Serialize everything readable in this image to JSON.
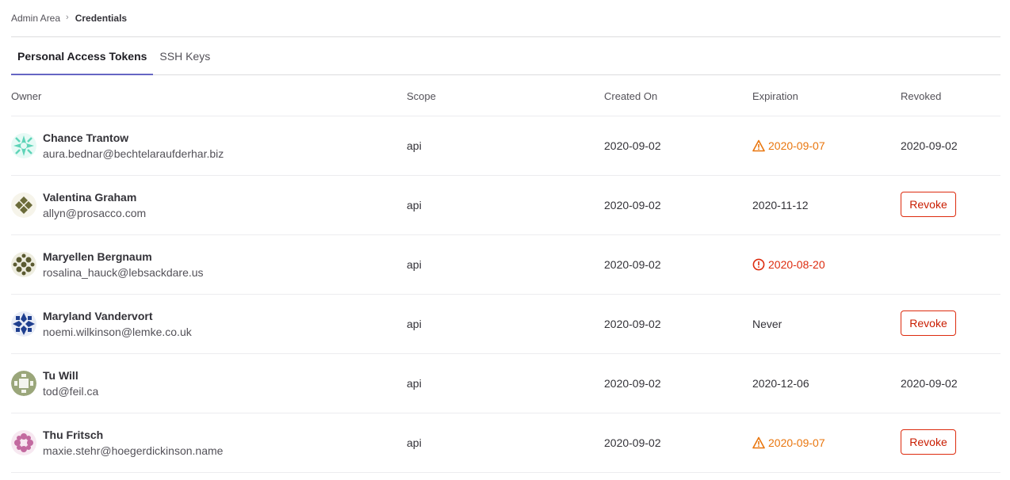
{
  "breadcrumb": {
    "parent": "Admin Area",
    "separator": "›",
    "current": "Credentials"
  },
  "tabs": [
    {
      "label": "Personal Access Tokens",
      "active": true
    },
    {
      "label": "SSH Keys",
      "active": false
    }
  ],
  "table": {
    "headers": {
      "owner": "Owner",
      "scope": "Scope",
      "created": "Created On",
      "expiration": "Expiration",
      "revoked": "Revoked"
    },
    "rows": [
      {
        "name": "Chance Trantow",
        "email": "aura.bednar@bechtelaraufderhar.biz",
        "scope": "api",
        "created": "2020-09-02",
        "expiration": "2020-09-07",
        "expiration_status": "warning",
        "revoked": "2020-09-02",
        "revoke_label": "",
        "avatar_color": "#5fd4b8"
      },
      {
        "name": "Valentina Graham",
        "email": "allyn@prosacco.com",
        "scope": "api",
        "created": "2020-09-02",
        "expiration": "2020-11-12",
        "expiration_status": "normal",
        "revoked": "",
        "revoke_label": "Revoke",
        "avatar_color": "#6b6b3a"
      },
      {
        "name": "Maryellen Bergnaum",
        "email": "rosalina_hauck@lebsackdare.us",
        "scope": "api",
        "created": "2020-09-02",
        "expiration": "2020-08-20",
        "expiration_status": "expired",
        "revoked": "",
        "revoke_label": "",
        "avatar_color": "#5a5a30"
      },
      {
        "name": "Maryland Vandervort",
        "email": "noemi.wilkinson@lemke.co.uk",
        "scope": "api",
        "created": "2020-09-02",
        "expiration": "Never",
        "expiration_status": "normal",
        "revoked": "",
        "revoke_label": "Revoke",
        "avatar_color": "#1f3f8f"
      },
      {
        "name": "Tu Will",
        "email": "tod@feil.ca",
        "scope": "api",
        "created": "2020-09-02",
        "expiration": "2020-12-06",
        "expiration_status": "normal",
        "revoked": "2020-09-02",
        "revoke_label": "",
        "avatar_color": "#9aa67a"
      },
      {
        "name": "Thu Fritsch",
        "email": "maxie.stehr@hoegerdickinson.name",
        "scope": "api",
        "created": "2020-09-02",
        "expiration": "2020-09-07",
        "expiration_status": "warning",
        "revoked": "",
        "revoke_label": "Revoke",
        "avatar_color": "#c36aa0"
      }
    ]
  },
  "colors": {
    "warning": "#e9760e",
    "danger": "#dd2b0e",
    "tab_active_underline": "#6666c4"
  },
  "icons": {
    "warning": "warning-icon",
    "expired": "error-icon"
  }
}
